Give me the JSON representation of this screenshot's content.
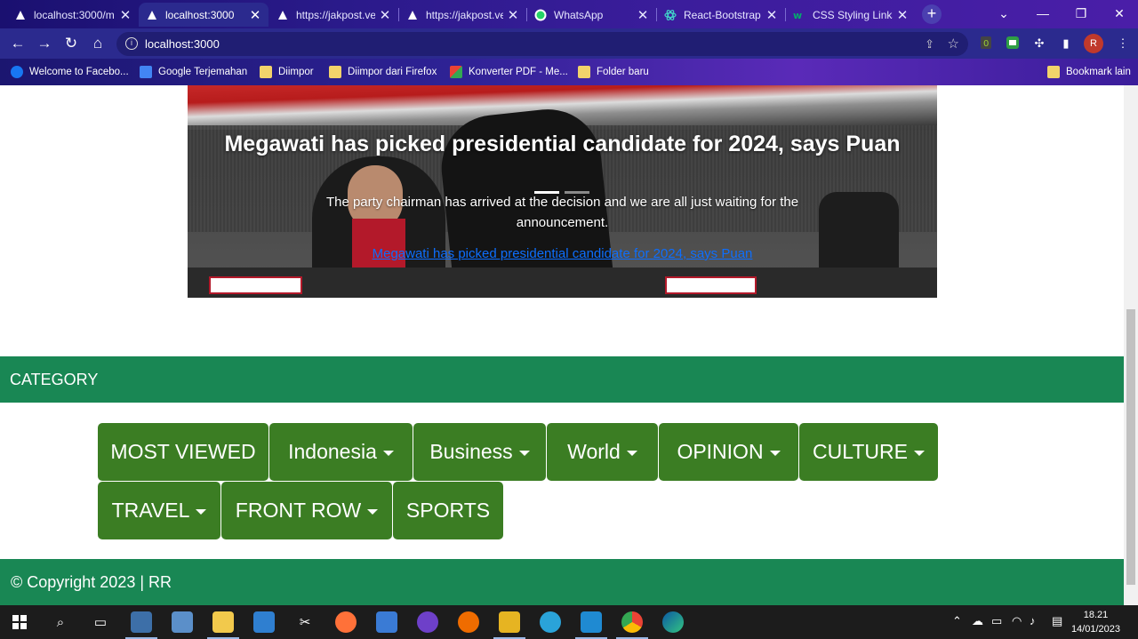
{
  "browser": {
    "tabs": [
      {
        "label": "localhost:3000/m",
        "icon": "triangle-favicon"
      },
      {
        "label": "localhost:3000",
        "icon": "triangle-favicon",
        "active": true
      },
      {
        "label": "https://jakpost.ve",
        "icon": "triangle-favicon"
      },
      {
        "label": "https://jakpost.ve",
        "icon": "triangle-favicon"
      },
      {
        "label": "WhatsApp",
        "icon": "whatsapp-favicon"
      },
      {
        "label": "React-Bootstrap",
        "icon": "react-bootstrap-favicon"
      },
      {
        "label": "CSS Styling Links",
        "icon": "w3schools-favicon"
      }
    ],
    "close_glyph": "✕",
    "new_tab_glyph": "+",
    "url": "localhost:3000",
    "profile_initial": "R",
    "bookmarks": [
      {
        "label": "Welcome to Facebo...",
        "icon": "facebook-icon"
      },
      {
        "label": "Google Terjemahan",
        "icon": "google-translate-icon"
      },
      {
        "label": "Diimpor",
        "icon": "folder-icon"
      },
      {
        "label": "Diimpor dari Firefox",
        "icon": "folder-icon"
      },
      {
        "label": "Konverter PDF - Me...",
        "icon": "pdf-converter-icon"
      },
      {
        "label": "Folder baru",
        "icon": "folder-icon"
      }
    ],
    "other_bookmarks": "Bookmark lain"
  },
  "carousel": {
    "title": "Megawati has picked presidential candidate for 2024, says Puan",
    "description": "The party chairman has arrived at the decision and we are all just waiting for the announcement.",
    "link_text": "Megawati has picked presidential candidate for 2024, says Puan",
    "active_slide": 0,
    "slide_count": 2
  },
  "category": {
    "heading": "CATEGORY",
    "items": [
      {
        "label": "MOST VIEWED",
        "dropdown": false
      },
      {
        "label": "Indonesia",
        "dropdown": true
      },
      {
        "label": "Business",
        "dropdown": true
      },
      {
        "label": "World",
        "dropdown": true
      },
      {
        "label": "OPINION",
        "dropdown": true
      },
      {
        "label": "CULTURE",
        "dropdown": true
      },
      {
        "label": "TRAVEL",
        "dropdown": true
      },
      {
        "label": "FRONT ROW",
        "dropdown": true
      },
      {
        "label": "SPORTS",
        "dropdown": false
      }
    ]
  },
  "footer": {
    "text": "© Copyright 2023 | RR"
  },
  "taskbar": {
    "time": "18.21",
    "date": "14/01/2023"
  },
  "colors": {
    "accent_green": "#198754",
    "menu_green": "#3b7d23",
    "link_blue": "#0d6efd"
  }
}
